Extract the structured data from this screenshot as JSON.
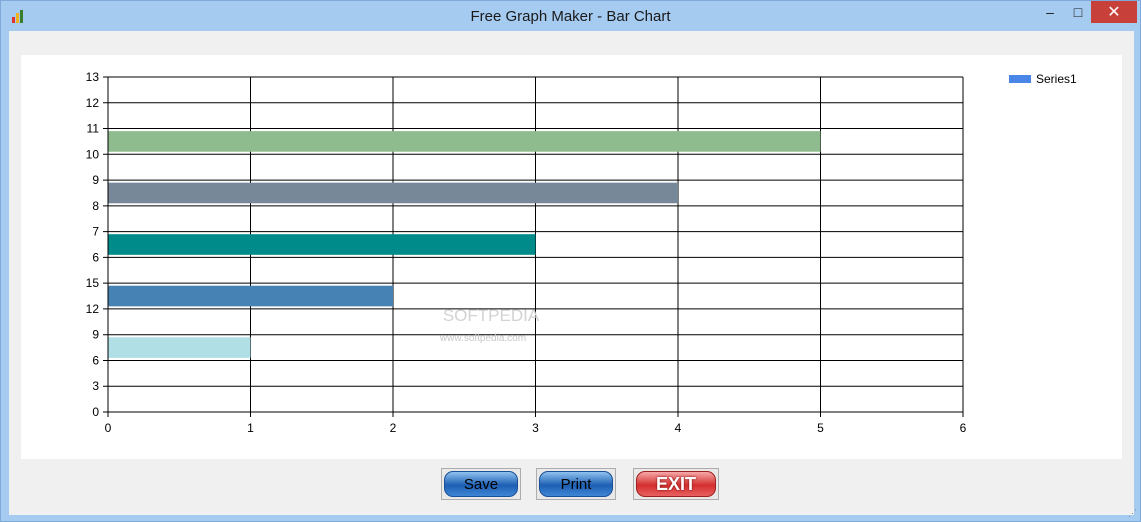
{
  "window": {
    "title": "Free Graph Maker - Bar Chart",
    "controls": {
      "minimize": "–",
      "maximize": "□",
      "close": "✕"
    }
  },
  "buttons": {
    "save": "Save",
    "print": "Print",
    "exit": "EXIT"
  },
  "watermark": {
    "logo": "SOFTPEDIA",
    "url": "www.softpedia.com"
  },
  "chart_data": {
    "type": "bar",
    "orientation": "horizontal",
    "series": [
      {
        "name": "Series1",
        "legend_color": "#4a86e8",
        "values": [
          1,
          2,
          3,
          4,
          5
        ],
        "colors": [
          "#b0dfe6",
          "#4682b4",
          "#008b8b",
          "#778899",
          "#8fbc8f"
        ]
      }
    ],
    "bar_y_positions": [
      2.5,
      4.5,
      6.5,
      8.5,
      10.5
    ],
    "x_ticks": [
      "0",
      "1",
      "2",
      "3",
      "4",
      "5",
      "6"
    ],
    "y_ticks": [
      "0",
      "3",
      "6",
      "9",
      "12",
      "15",
      "6",
      "7",
      "8",
      "9",
      "10",
      "11",
      "12",
      "13"
    ],
    "xlim": [
      0,
      6
    ],
    "ylim": [
      0,
      13
    ],
    "grid": true,
    "legend_position": "top-right"
  }
}
